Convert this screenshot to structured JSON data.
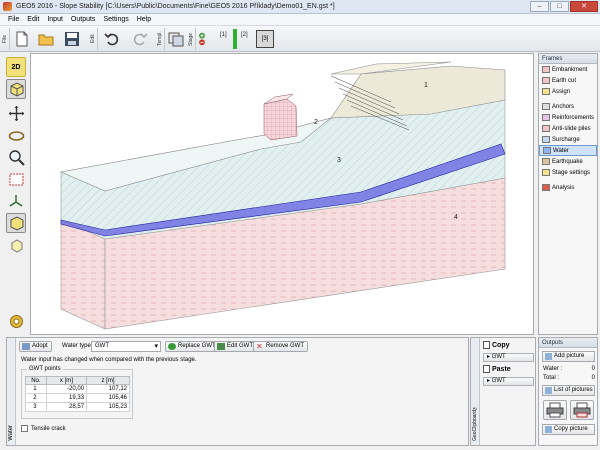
{
  "window": {
    "title": "GEO5 2016 - Slope Stability [C:\\Users\\Public\\Documents\\Fine\\GEO5 2016 Příklady\\Demo01_EN.gst *]",
    "minimize": "‒",
    "maximize": "□",
    "close": "✕"
  },
  "menu": [
    "File",
    "Edit",
    "Input",
    "Outputs",
    "Settings",
    "Help"
  ],
  "toolbar": {
    "group_labels": [
      "File",
      "Edit",
      "Templ.",
      "Stage"
    ],
    "stages": [
      "[1]",
      "[2]",
      "[3]"
    ],
    "active_stage": "[3]"
  },
  "left_tools": [
    "2D",
    "3D",
    "move-icon",
    "rotate-icon",
    "zoom-icon",
    "fit-icon",
    "axes-icon",
    "cube-icon",
    "cube-small-icon",
    "settings-icon"
  ],
  "canvas": {
    "labels": [
      "1",
      "2",
      "3",
      "4"
    ],
    "colors": {
      "embankment": "#ece9d8",
      "layer_upper": "#e2f0f0",
      "layer_lower": "#f6dedf",
      "water": "#3a3ad0",
      "hatch": "#7aa0b8"
    }
  },
  "frames": {
    "header": "Frames",
    "items": [
      {
        "label": "Embankment",
        "icon": "embankment-icon"
      },
      {
        "label": "Earth cut",
        "icon": "earth-cut-icon"
      },
      {
        "label": "Assign",
        "icon": "assign-icon"
      },
      {
        "label": "Anchors",
        "icon": "anchors-icon"
      },
      {
        "label": "Reinforcements",
        "icon": "reinforcements-icon"
      },
      {
        "label": "Anti-slide piles",
        "icon": "anti-slide-piles-icon"
      },
      {
        "label": "Surcharge",
        "icon": "surcharge-icon"
      },
      {
        "label": "Water",
        "icon": "water-icon"
      },
      {
        "label": "Earthquake",
        "icon": "earthquake-icon"
      },
      {
        "label": "Stage settings",
        "icon": "stage-settings-icon"
      },
      {
        "label": "Analysis",
        "icon": "analysis-icon"
      }
    ],
    "active": "Water"
  },
  "water_panel": {
    "tab_label": "Water",
    "adopt": "Adopt",
    "water_type_label": "Water type :",
    "water_type_value": "GWT",
    "replace": "Replace GWT",
    "edit": "Edit GWT",
    "remove": "Remove GWT",
    "message": "Water input has changed when compared with the previous stage.",
    "gwt_points_title": "GWT points",
    "table": {
      "headers": [
        "No.",
        "x [m]",
        "z [m]"
      ],
      "rows": [
        {
          "no": "1",
          "x": "-20,00",
          "z": "107,12"
        },
        {
          "no": "2",
          "x": "19,33",
          "z": "105,46"
        },
        {
          "no": "3",
          "x": "28,57",
          "z": "105,23"
        }
      ]
    },
    "tensile_crack": "Tensile crack"
  },
  "geo_clipboard": {
    "tab_label": "GeoClipboard™",
    "copy": "Copy",
    "copy_item": "GWT",
    "paste": "Paste",
    "paste_item": "GWT"
  },
  "outputs": {
    "header": "Outputs",
    "add_picture": "Add picture",
    "water_label": "Water :",
    "water_count": "0",
    "total_label": "Total :",
    "total_count": "0",
    "list_of_pictures": "List of pictures",
    "copy_picture": "Copy picture"
  }
}
